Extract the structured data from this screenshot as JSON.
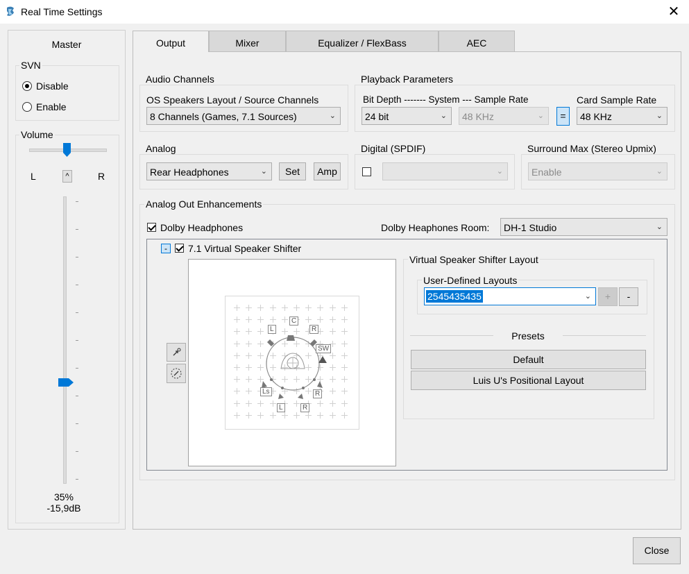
{
  "window": {
    "title": "Real Time Settings",
    "close_glyph": "✕"
  },
  "master": {
    "heading": "Master",
    "svn": {
      "label": "SVN",
      "options": [
        "Disable",
        "Enable"
      ],
      "selected": "Disable"
    },
    "volume": {
      "label": "Volume",
      "left": "L",
      "center": "^",
      "right": "R",
      "percent": "35%",
      "db": "-15,9dB",
      "level": 0.35
    }
  },
  "tabs": [
    "Output",
    "Mixer",
    "Equalizer / FlexBass",
    "AEC"
  ],
  "active_tab": "Output",
  "audio_channels": {
    "label": "Audio Channels",
    "sub_label": "OS Speakers Layout / Source Channels",
    "value": "8 Channels (Games, 7.1 Sources)"
  },
  "playback": {
    "label": "Playback Parameters",
    "bitdepth_label": "Bit Depth ------- System --- Sample Rate",
    "bitdepth_value": "24 bit",
    "system_rate_value": "48 KHz",
    "link_button": "=",
    "card_rate_label": "Card Sample Rate",
    "card_rate_value": "48 KHz"
  },
  "analog": {
    "label": "Analog",
    "value": "Rear Headphones",
    "set_button": "Set",
    "amp_button": "Amp"
  },
  "digital": {
    "label": "Digital (SPDIF)",
    "value": ""
  },
  "surround": {
    "label": "Surround Max (Stereo Upmix)",
    "value": "Enable"
  },
  "enhancements": {
    "label": "Analog Out Enhancements",
    "dolby_label": "Dolby Headphones",
    "room_label": "Dolby Heaphones Room:",
    "room_value": "DH-1 Studio",
    "collapse_glyph": "-",
    "shifter_label": "7.1 Virtual Speaker Shifter",
    "speakers": [
      "L",
      "C",
      "R",
      "SW",
      "Ls",
      "R",
      "L",
      "R"
    ]
  },
  "vss_layout": {
    "label": "Virtual Speaker Shifter Layout",
    "user_label": "User-Defined Layouts",
    "user_value": "2545435435",
    "plus": "+",
    "minus": "-",
    "presets_label": "Presets",
    "presets": [
      "Default",
      "Luis U's Positional Layout"
    ]
  },
  "footer": {
    "close_button": "Close"
  },
  "colors": {
    "accent": "#0078d7",
    "selection": "#0078d7",
    "link_button_bg": "#cce4f7"
  }
}
